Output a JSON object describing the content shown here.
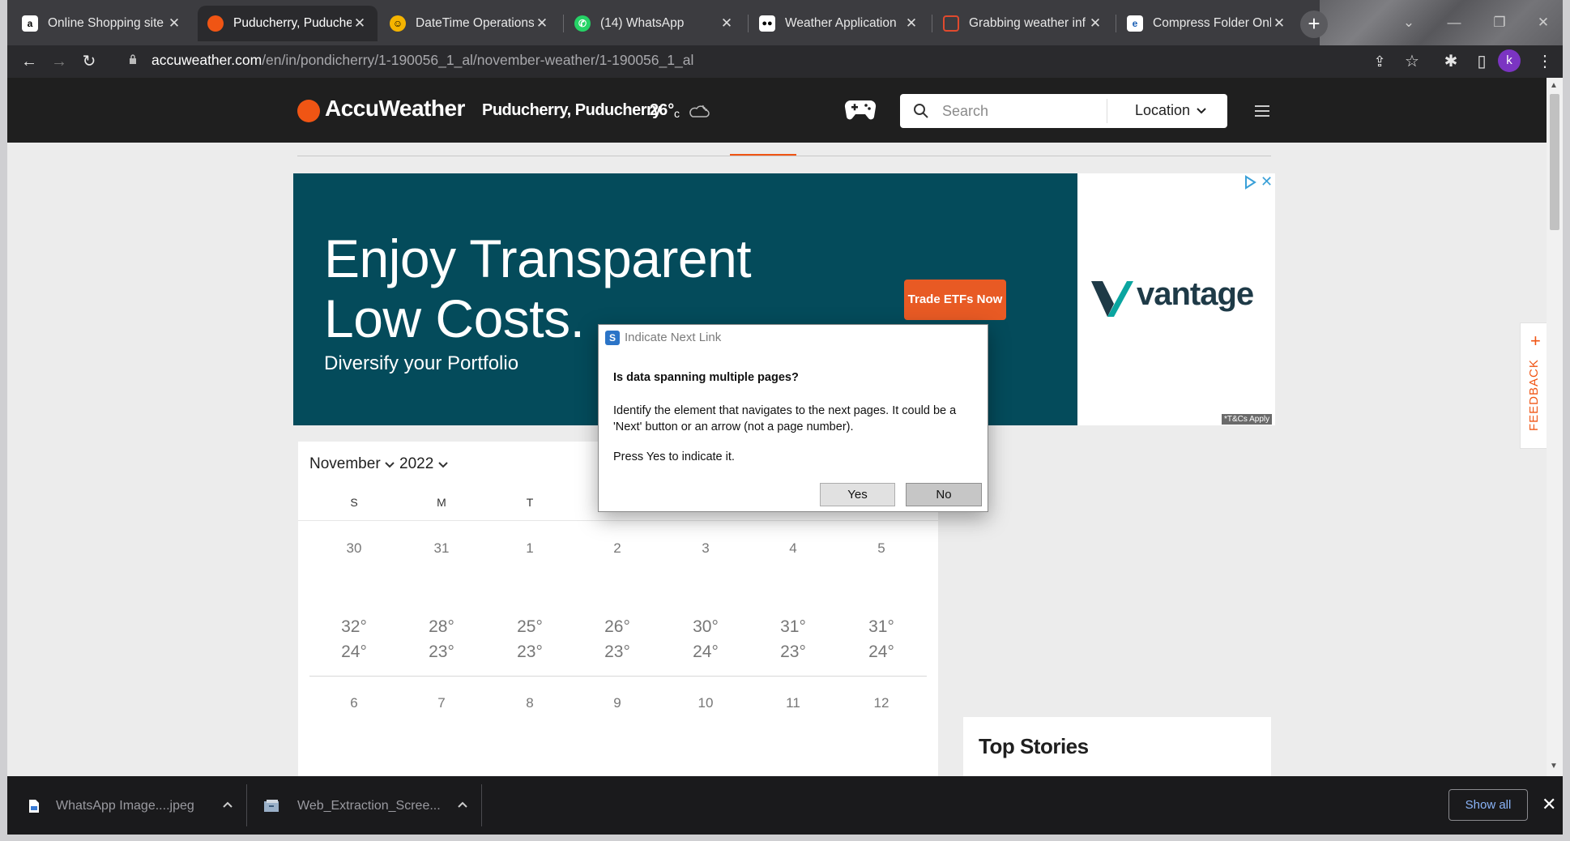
{
  "browser": {
    "tabs": [
      {
        "title": "Online Shopping site",
        "favicon": "amazon-icon",
        "color": "#ffffff",
        "active": false
      },
      {
        "title": "Puducherry, Puduche",
        "favicon": "accuweather-icon",
        "color": "#f05514",
        "active": true
      },
      {
        "title": "DateTime Operations",
        "favicon": "smiley-icon",
        "color": "#f5b400",
        "active": false
      },
      {
        "title": "(14) WhatsApp",
        "favicon": "whatsapp-icon",
        "color": "#25d366",
        "active": false
      },
      {
        "title": "Weather Application",
        "favicon": "medium-icon",
        "color": "#000000",
        "active": false
      },
      {
        "title": "Grabbing weather inf",
        "favicon": "slides-icon",
        "color": "#e04a2e",
        "active": false
      },
      {
        "title": "Compress Folder Onl",
        "favicon": "ezyzip-icon",
        "color": "#1a5fb4",
        "active": false
      }
    ],
    "url_host": "accuweather.com",
    "url_path": "/en/in/pondicherry/1-190056_1_al/november-weather/1-190056_1_al",
    "profile_initial": "k"
  },
  "site": {
    "logo": "AccuWeather",
    "location": "Puducherry, Puducherry",
    "temp": "26°",
    "unit": "c",
    "search_placeholder": "Search",
    "location_button": "Location"
  },
  "ad": {
    "headline": "Enjoy Transparent Low Costs.",
    "subhead": "Diversify your Portfolio",
    "cta": "Trade ETFs Now",
    "brand": "vantage",
    "terms": "*T&Cs Apply",
    "bg_color": "#044b5b",
    "cta_color": "#e85a24"
  },
  "calendar": {
    "month": "November",
    "year": "2022",
    "weekdays": [
      "S",
      "M",
      "T"
    ],
    "week1": {
      "days": [
        "30",
        "31",
        "1",
        "2",
        "3",
        "4",
        "5"
      ],
      "highs": [
        "32°",
        "28°",
        "25°",
        "26°",
        "30°",
        "31°",
        "31°"
      ],
      "lows": [
        "24°",
        "23°",
        "23°",
        "23°",
        "24°",
        "23°",
        "24°"
      ]
    },
    "week2": {
      "days": [
        "6",
        "7",
        "8",
        "9",
        "10",
        "11",
        "12"
      ]
    }
  },
  "sidebar": {
    "top_stories": "Top Stories",
    "feedback": "FEEDBACK"
  },
  "dialog": {
    "title": "Indicate Next Link",
    "question": "Is data spanning multiple pages?",
    "body": "Identify the element that navigates to the next pages. It could be a 'Next' button or an arrow (not a page number).",
    "instruction": "Press Yes to indicate it.",
    "yes": "Yes",
    "no": "No"
  },
  "downloads": {
    "items": [
      {
        "name": "WhatsApp Image....jpeg",
        "icon": "image-file-icon"
      },
      {
        "name": "Web_Extraction_Scree...",
        "icon": "archive-file-icon"
      }
    ],
    "show_all": "Show all"
  },
  "colors": {
    "accent": "#f05514",
    "header_bg": "#1f1f1f"
  }
}
